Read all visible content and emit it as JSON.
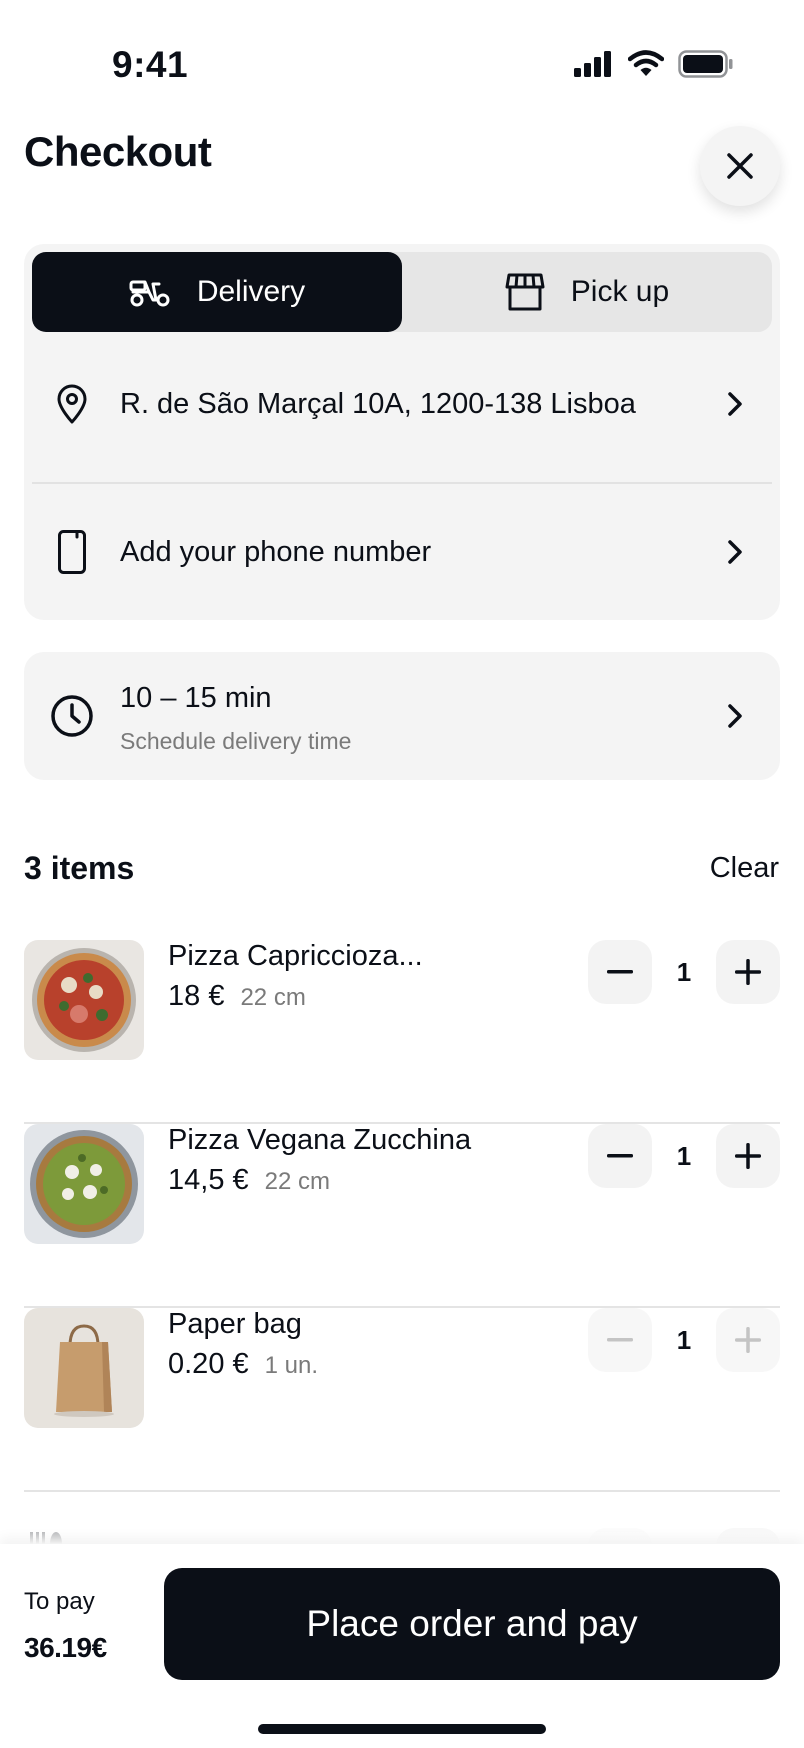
{
  "status_bar": {
    "time": "9:41"
  },
  "header": {
    "title": "Checkout"
  },
  "delivery_mode": {
    "options": [
      {
        "label": "Delivery",
        "icon": "scooter-icon",
        "selected": true
      },
      {
        "label": "Pick up",
        "icon": "storefront-icon",
        "selected": false
      }
    ]
  },
  "address": {
    "text": "R. de São Marçal 10A, 1200-138 Lisboa",
    "icon": "location-pin-icon"
  },
  "phone": {
    "text": "Add your phone number",
    "icon": "phone-icon"
  },
  "delivery_time": {
    "eta": "10 – 15 min",
    "subtitle": "Schedule delivery time",
    "icon": "clock-icon"
  },
  "items_section": {
    "heading": "3 items",
    "clear_label": "Clear",
    "items": [
      {
        "name": "Pizza Capriccioza...",
        "price": "18 €",
        "size": "22 cm",
        "qty": "1",
        "enabled": true
      },
      {
        "name": "Pizza Vegana Zucchina",
        "price": "14,5 €",
        "size": "22 cm",
        "qty": "1",
        "enabled": true
      },
      {
        "name": "Paper bag",
        "price": "0.20 €",
        "size": "1 un.",
        "qty": "1",
        "enabled": false
      }
    ]
  },
  "footer": {
    "to_pay_label": "To pay",
    "to_pay_amount": "36.19€",
    "pay_button": "Place order and pay"
  },
  "colors": {
    "primary": "#0b0f17",
    "surface": "#f4f4f4",
    "muted_text": "#7a7a7a"
  }
}
